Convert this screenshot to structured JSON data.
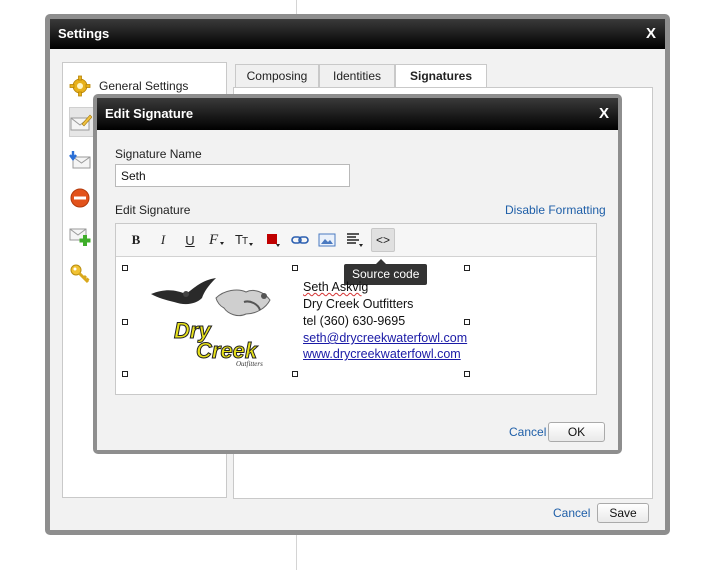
{
  "settings": {
    "title": "Settings",
    "close_glyph": "X",
    "sidebar": {
      "items": [
        {
          "label": "General Settings",
          "icon": "gear-icon"
        },
        {
          "label": "",
          "icon": "envelope-pencil-icon"
        },
        {
          "label": "",
          "icon": "envelope-download-icon"
        },
        {
          "label": "",
          "icon": "blocked-icon"
        },
        {
          "label": "",
          "icon": "envelope-add-icon"
        },
        {
          "label": "",
          "icon": "key-icon"
        }
      ]
    },
    "tabs": [
      {
        "label": "Composing"
      },
      {
        "label": "Identities"
      },
      {
        "label": "Signatures"
      }
    ],
    "footer": {
      "cancel_label": "Cancel",
      "save_label": "Save"
    }
  },
  "dialog": {
    "title": "Edit Signature",
    "close_glyph": "X",
    "name_label": "Signature Name",
    "name_value": "Seth",
    "edit_label": "Edit Signature",
    "disable_formatting_label": "Disable Formatting",
    "toolbar": {
      "bold": "B",
      "italic": "I",
      "underline": "U",
      "source_code_glyph": "<>",
      "tooltip": "Source code"
    },
    "signature": {
      "logo": {
        "line1": "Dry",
        "line2": "Creek",
        "tagline": "Outfitters"
      },
      "lines": [
        {
          "text": "Seth Askvig",
          "kind": "text"
        },
        {
          "text": "Dry Creek Outfitters",
          "kind": "text"
        },
        {
          "text": "tel (360) 630-9695",
          "kind": "text"
        },
        {
          "text": "seth@drycreekwaterfowl.com",
          "kind": "link"
        },
        {
          "text": "www.drycreekwaterfowl.com",
          "kind": "link"
        }
      ]
    },
    "cancel_label": "Cancel",
    "ok_label": "OK"
  },
  "colors": {
    "titlebar": "#000000",
    "link": "#1f5fa8",
    "font_color_swatch": "#c00000",
    "logo_yellow": "#e8e21a"
  }
}
